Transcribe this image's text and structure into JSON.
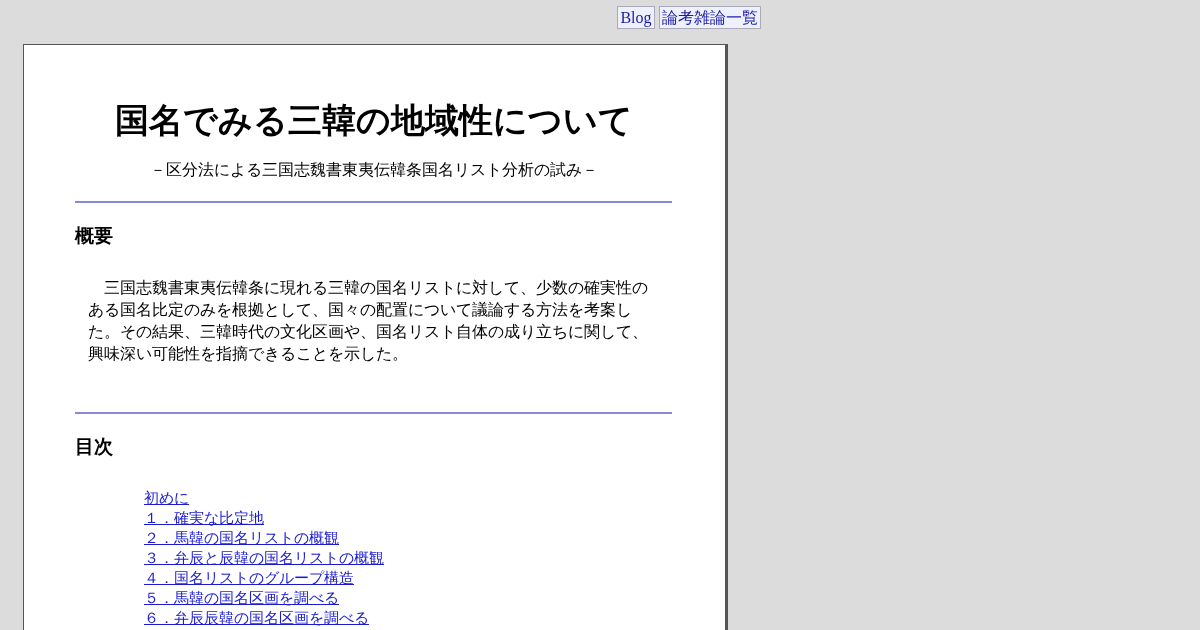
{
  "nav_links": [
    "Blog",
    "論考雑論一覧"
  ],
  "title": "国名でみる三韓の地域性について",
  "subtitle": "－区分法による三国志魏書東夷伝韓条国名リスト分析の試み－",
  "abstract": {
    "heading": "概要",
    "text": "三国志魏書東夷伝韓条に現れる三韓の国名リストに対して、少数の確実性のある国名比定のみを根拠として、国々の配置について議論する方法を考案した。その結果、三韓時代の文化区画や、国名リスト自体の成り立ちに関して、興味深い可能性を指摘できることを示した。"
  },
  "toc": {
    "heading": "目次",
    "items": [
      "初めに",
      "１．確実な比定地",
      "２．馬韓の国名リストの概観",
      "３．弁辰と辰韓の国名リストの概観",
      "４．国名リストのグループ構造",
      "５．馬韓の国名区画を調べる",
      "６．弁辰辰韓の国名区画を調べる"
    ]
  }
}
